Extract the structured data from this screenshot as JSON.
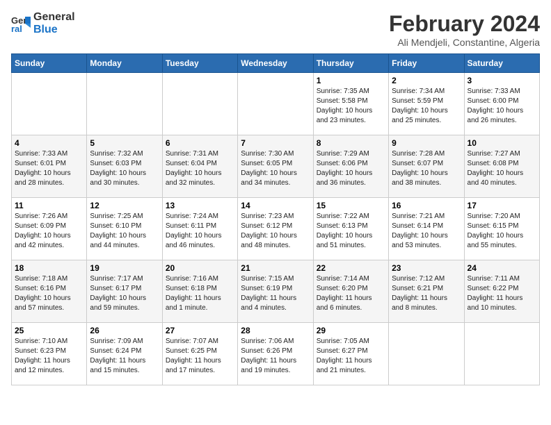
{
  "header": {
    "logo_line1": "General",
    "logo_line2": "Blue",
    "title": "February 2024",
    "subtitle": "Ali Mendjeli, Constantine, Algeria"
  },
  "weekdays": [
    "Sunday",
    "Monday",
    "Tuesday",
    "Wednesday",
    "Thursday",
    "Friday",
    "Saturday"
  ],
  "weeks": [
    [
      {
        "day": "",
        "info": ""
      },
      {
        "day": "",
        "info": ""
      },
      {
        "day": "",
        "info": ""
      },
      {
        "day": "",
        "info": ""
      },
      {
        "day": "1",
        "info": "Sunrise: 7:35 AM\nSunset: 5:58 PM\nDaylight: 10 hours\nand 23 minutes."
      },
      {
        "day": "2",
        "info": "Sunrise: 7:34 AM\nSunset: 5:59 PM\nDaylight: 10 hours\nand 25 minutes."
      },
      {
        "day": "3",
        "info": "Sunrise: 7:33 AM\nSunset: 6:00 PM\nDaylight: 10 hours\nand 26 minutes."
      }
    ],
    [
      {
        "day": "4",
        "info": "Sunrise: 7:33 AM\nSunset: 6:01 PM\nDaylight: 10 hours\nand 28 minutes."
      },
      {
        "day": "5",
        "info": "Sunrise: 7:32 AM\nSunset: 6:03 PM\nDaylight: 10 hours\nand 30 minutes."
      },
      {
        "day": "6",
        "info": "Sunrise: 7:31 AM\nSunset: 6:04 PM\nDaylight: 10 hours\nand 32 minutes."
      },
      {
        "day": "7",
        "info": "Sunrise: 7:30 AM\nSunset: 6:05 PM\nDaylight: 10 hours\nand 34 minutes."
      },
      {
        "day": "8",
        "info": "Sunrise: 7:29 AM\nSunset: 6:06 PM\nDaylight: 10 hours\nand 36 minutes."
      },
      {
        "day": "9",
        "info": "Sunrise: 7:28 AM\nSunset: 6:07 PM\nDaylight: 10 hours\nand 38 minutes."
      },
      {
        "day": "10",
        "info": "Sunrise: 7:27 AM\nSunset: 6:08 PM\nDaylight: 10 hours\nand 40 minutes."
      }
    ],
    [
      {
        "day": "11",
        "info": "Sunrise: 7:26 AM\nSunset: 6:09 PM\nDaylight: 10 hours\nand 42 minutes."
      },
      {
        "day": "12",
        "info": "Sunrise: 7:25 AM\nSunset: 6:10 PM\nDaylight: 10 hours\nand 44 minutes."
      },
      {
        "day": "13",
        "info": "Sunrise: 7:24 AM\nSunset: 6:11 PM\nDaylight: 10 hours\nand 46 minutes."
      },
      {
        "day": "14",
        "info": "Sunrise: 7:23 AM\nSunset: 6:12 PM\nDaylight: 10 hours\nand 48 minutes."
      },
      {
        "day": "15",
        "info": "Sunrise: 7:22 AM\nSunset: 6:13 PM\nDaylight: 10 hours\nand 51 minutes."
      },
      {
        "day": "16",
        "info": "Sunrise: 7:21 AM\nSunset: 6:14 PM\nDaylight: 10 hours\nand 53 minutes."
      },
      {
        "day": "17",
        "info": "Sunrise: 7:20 AM\nSunset: 6:15 PM\nDaylight: 10 hours\nand 55 minutes."
      }
    ],
    [
      {
        "day": "18",
        "info": "Sunrise: 7:18 AM\nSunset: 6:16 PM\nDaylight: 10 hours\nand 57 minutes."
      },
      {
        "day": "19",
        "info": "Sunrise: 7:17 AM\nSunset: 6:17 PM\nDaylight: 10 hours\nand 59 minutes."
      },
      {
        "day": "20",
        "info": "Sunrise: 7:16 AM\nSunset: 6:18 PM\nDaylight: 11 hours\nand 1 minute."
      },
      {
        "day": "21",
        "info": "Sunrise: 7:15 AM\nSunset: 6:19 PM\nDaylight: 11 hours\nand 4 minutes."
      },
      {
        "day": "22",
        "info": "Sunrise: 7:14 AM\nSunset: 6:20 PM\nDaylight: 11 hours\nand 6 minutes."
      },
      {
        "day": "23",
        "info": "Sunrise: 7:12 AM\nSunset: 6:21 PM\nDaylight: 11 hours\nand 8 minutes."
      },
      {
        "day": "24",
        "info": "Sunrise: 7:11 AM\nSunset: 6:22 PM\nDaylight: 11 hours\nand 10 minutes."
      }
    ],
    [
      {
        "day": "25",
        "info": "Sunrise: 7:10 AM\nSunset: 6:23 PM\nDaylight: 11 hours\nand 12 minutes."
      },
      {
        "day": "26",
        "info": "Sunrise: 7:09 AM\nSunset: 6:24 PM\nDaylight: 11 hours\nand 15 minutes."
      },
      {
        "day": "27",
        "info": "Sunrise: 7:07 AM\nSunset: 6:25 PM\nDaylight: 11 hours\nand 17 minutes."
      },
      {
        "day": "28",
        "info": "Sunrise: 7:06 AM\nSunset: 6:26 PM\nDaylight: 11 hours\nand 19 minutes."
      },
      {
        "day": "29",
        "info": "Sunrise: 7:05 AM\nSunset: 6:27 PM\nDaylight: 11 hours\nand 21 minutes."
      },
      {
        "day": "",
        "info": ""
      },
      {
        "day": "",
        "info": ""
      }
    ]
  ]
}
